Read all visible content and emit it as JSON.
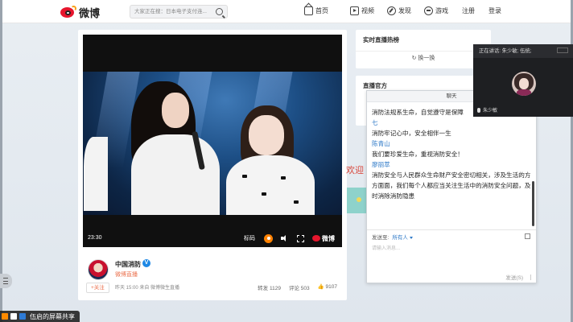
{
  "topnav": {
    "logo_text": "微博",
    "search_placeholder": "大家正在搜：日本电子支付连...",
    "items": [
      {
        "label": "首页",
        "icon": "home-icon"
      },
      {
        "label": "视频",
        "icon": "video-icon"
      },
      {
        "label": "发现",
        "icon": "compass-icon"
      },
      {
        "label": "游戏",
        "icon": "game-icon"
      }
    ],
    "register": "注册",
    "login": "登录"
  },
  "video": {
    "time": "23:30",
    "quality": "标码",
    "brand": "微博"
  },
  "post": {
    "author": "中国消防",
    "verified": "V",
    "subtitle": "微博直播",
    "follow": "+关注",
    "meta": "昨天 15:00 来自 微博微生直播",
    "reposts": "转发 1129",
    "comments": "评论 503",
    "likes": "9107"
  },
  "sidebar": {
    "hot_live_title": "实时直播热榜",
    "refresh_label": "换一换",
    "official_title": "直播官方",
    "welcome_text": "欢迎"
  },
  "chat": {
    "title": "聊天",
    "messages": [
      {
        "sender": "",
        "text": "消防法规系生命，自觉遵守是保障"
      },
      {
        "sender": "七",
        "text": "消防牢记心中，安全相伴一生"
      },
      {
        "sender": "陈青山",
        "text": "我们要珍爱生命，重视消防安全！"
      },
      {
        "sender": "廖丽萃",
        "text": "消防安全与人民群众生命财产安全密切相关，涉及生活的方方面面，我们每个人都应当关注生活中的消防安全问题，及时消除消防隐患"
      }
    ],
    "send_to_label": "发送至:",
    "send_to_value": "所有人",
    "input_placeholder": "请输入消息...",
    "send_label": "发送(S)"
  },
  "speaker": {
    "title": "正在讲话: 朱少敏; 伍统;",
    "name": "朱少敏"
  },
  "share_bar": {
    "text": "伍启的屏幕共享",
    "colors": [
      "#ff8a00",
      "#ffffff",
      "#2e7bd6"
    ]
  }
}
